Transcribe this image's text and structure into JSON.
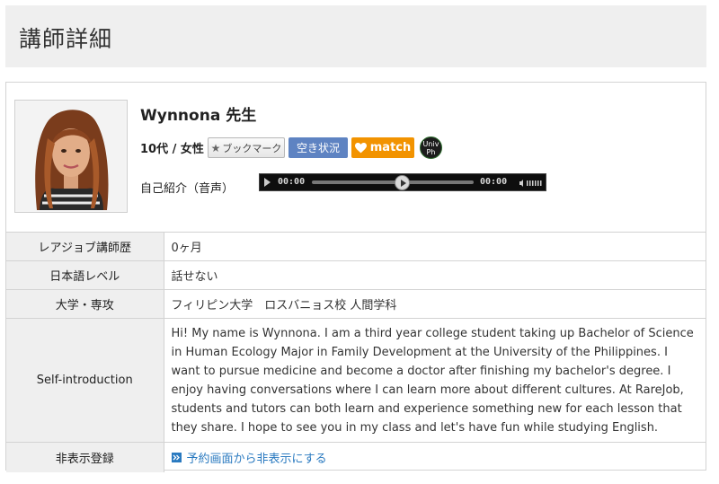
{
  "page": {
    "title": "講師詳細"
  },
  "profile": {
    "name": "Wynnona 先生",
    "age_gender": "10代 / 女性",
    "bookmark_label": "ブックマーク",
    "availability_label": "空き状況",
    "match_label": "match",
    "univ_badge": [
      "Univ",
      "Ph"
    ],
    "voice_label": "自己紹介（音声）",
    "audio": {
      "current_time": "00:00",
      "total_time": "00:00"
    }
  },
  "details": {
    "career": {
      "label": "レアジョブ講師歴",
      "value": "0ヶ月"
    },
    "japanese": {
      "label": "日本語レベル",
      "value": "話せない"
    },
    "university": {
      "label": "大学・専攻",
      "value": "フィリピン大学　ロスバニョス校  人間学科"
    },
    "intro": {
      "label": "Self-introduction",
      "value": "Hi! My name is Wynnona. I am a third year college student taking up Bachelor of Science in Human Ecology Major in Family Development at the University of the Philippines. I want to pursue medicine and become a doctor after finishing my bachelor's degree. I enjoy having conversations where I can learn more about different cultures. At RareJob, students and tutors can both learn and experience something new for each lesson that they share. I hope to see you in my class and let's have fun while studying English."
    },
    "hide": {
      "label": "非表示登録",
      "link_text": "予約画面から非表示にする"
    }
  },
  "colors": {
    "availability": "#5e83c2",
    "match": "#f29300",
    "link": "#2a7ac0",
    "header_bg": "#efefef"
  },
  "icons": {
    "bookmark": "star-icon",
    "match": "heart-icon",
    "play": "play-icon",
    "volume": "volume-icon",
    "link": "double-chevron-right-icon"
  }
}
